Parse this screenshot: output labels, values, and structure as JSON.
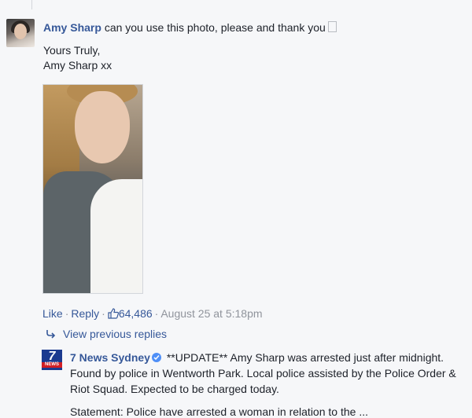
{
  "comment": {
    "author": "Amy Sharp",
    "text": "can you use this photo, please and thank you",
    "line2": "Yours Truly,",
    "line3": "Amy Sharp xx",
    "actions": {
      "like": "Like",
      "reply": "Reply",
      "reaction_count": "64,486",
      "timestamp": "August 25 at 5:18pm"
    }
  },
  "view_previous_replies": "View previous replies",
  "reply": {
    "author": "7 News Sydney",
    "logo_text": "7",
    "logo_word": "NEWS",
    "text": "**UPDATE** Amy Sharp was arrested just after midnight. Found by police in Wentworth Park. Local police assisted by the Police Order & Riot Squad. Expected to be charged today."
  },
  "truncated_next_line": "Statement: Police have arrested a woman in relation to the ...",
  "colors": {
    "link": "#365899",
    "meta": "#90949c",
    "background": "#f6f7f9",
    "verified": "#4f8ff7"
  }
}
